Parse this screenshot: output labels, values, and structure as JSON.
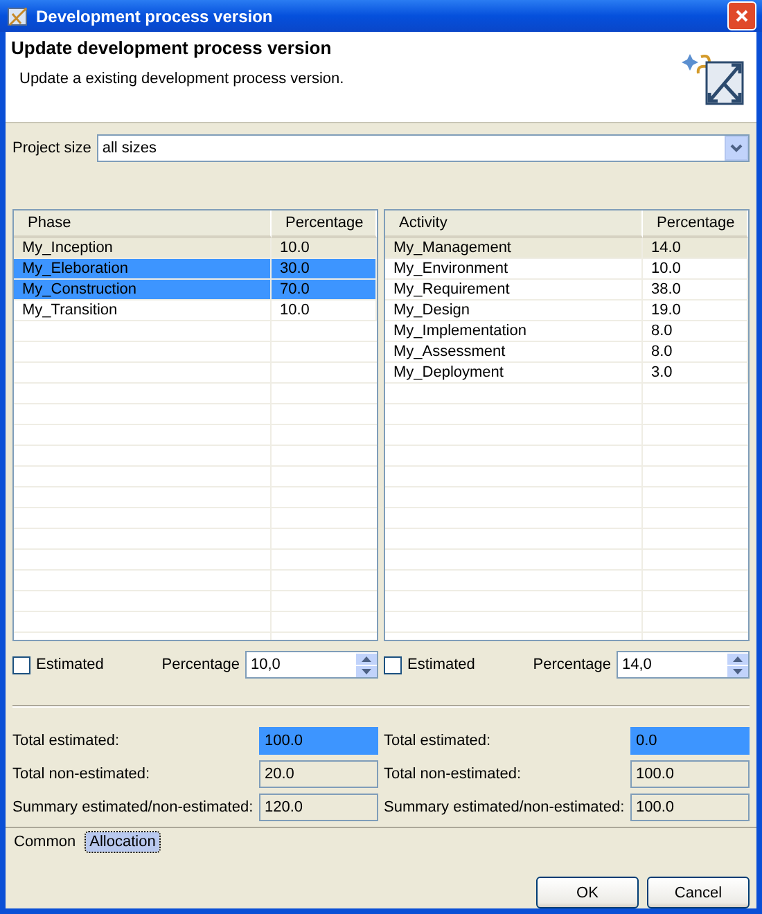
{
  "window": {
    "title": "Development process version"
  },
  "header": {
    "title": "Update development process version",
    "description": "Update a existing development process version."
  },
  "project_size": {
    "label": "Project size",
    "value": "all sizes"
  },
  "tables": [
    {
      "columns": [
        "Phase",
        "Percentage"
      ],
      "rows": [
        {
          "cells": [
            "My_Inception",
            "10.0"
          ],
          "focused": true,
          "selected": false
        },
        {
          "cells": [
            "My_Eleboration",
            "30.0"
          ],
          "focused": false,
          "selected": true
        },
        {
          "cells": [
            "My_Construction",
            "70.0"
          ],
          "focused": false,
          "selected": true
        },
        {
          "cells": [
            "My_Transition",
            "10.0"
          ],
          "focused": false,
          "selected": false
        }
      ],
      "estimated": {
        "label": "Estimated",
        "checked": false
      },
      "percentage": {
        "label": "Percentage",
        "value": "10,0"
      },
      "totals": [
        {
          "label": "Total estimated:",
          "value": "100.0",
          "highlighted": true
        },
        {
          "label": "Total non-estimated:",
          "value": "20.0",
          "highlighted": false
        },
        {
          "label": "Summary estimated/non-estimated:",
          "value": "120.0",
          "highlighted": false
        }
      ]
    },
    {
      "columns": [
        "Activity",
        "Percentage"
      ],
      "rows": [
        {
          "cells": [
            "My_Management",
            "14.0"
          ],
          "focused": true,
          "selected": false
        },
        {
          "cells": [
            "My_Environment",
            "10.0"
          ],
          "focused": false,
          "selected": false
        },
        {
          "cells": [
            "My_Requirement",
            "38.0"
          ],
          "focused": false,
          "selected": false
        },
        {
          "cells": [
            "My_Design",
            "19.0"
          ],
          "focused": false,
          "selected": false
        },
        {
          "cells": [
            "My_Implementation",
            "8.0"
          ],
          "focused": false,
          "selected": false
        },
        {
          "cells": [
            "My_Assessment",
            "8.0"
          ],
          "focused": false,
          "selected": false
        },
        {
          "cells": [
            "My_Deployment",
            "3.0"
          ],
          "focused": false,
          "selected": false
        }
      ],
      "estimated": {
        "label": "Estimated",
        "checked": false
      },
      "percentage": {
        "label": "Percentage",
        "value": "14,0"
      },
      "totals": [
        {
          "label": "Total estimated:",
          "value": "0.0",
          "highlighted": true
        },
        {
          "label": "Total non-estimated:",
          "value": "100.0",
          "highlighted": false
        },
        {
          "label": "Summary estimated/non-estimated:",
          "value": "100.0",
          "highlighted": false
        }
      ]
    }
  ],
  "tabs": [
    {
      "label": "Common",
      "selected": false
    },
    {
      "label": "Allocation",
      "selected": true
    }
  ],
  "buttons": [
    "OK",
    "Cancel"
  ]
}
